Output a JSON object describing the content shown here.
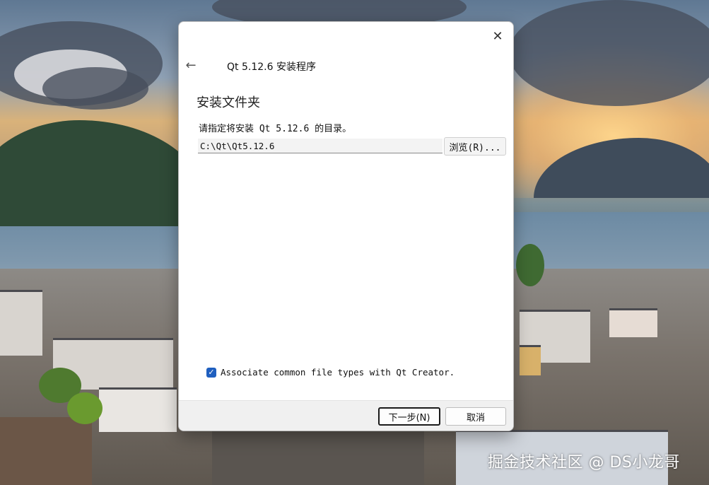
{
  "wallpaper": {
    "watermark": "掘金技术社区 @ DS小龙哥"
  },
  "dialog": {
    "title": "Qt 5.12.6 安装程序",
    "close_icon": "close-icon",
    "back_icon": "back-arrow-icon",
    "section_heading": "安装文件夹",
    "instruction": "请指定将安装 Qt 5.12.6 的目录。",
    "install_path": "C:\\Qt\\Qt5.12.6",
    "browse_label": "浏览(R)...",
    "associate_checked": true,
    "associate_label": "Associate common file types with Qt Creator.",
    "next_label": "下一步(N)",
    "cancel_label": "取消"
  },
  "colors": {
    "accent": "#1f5fbf"
  }
}
